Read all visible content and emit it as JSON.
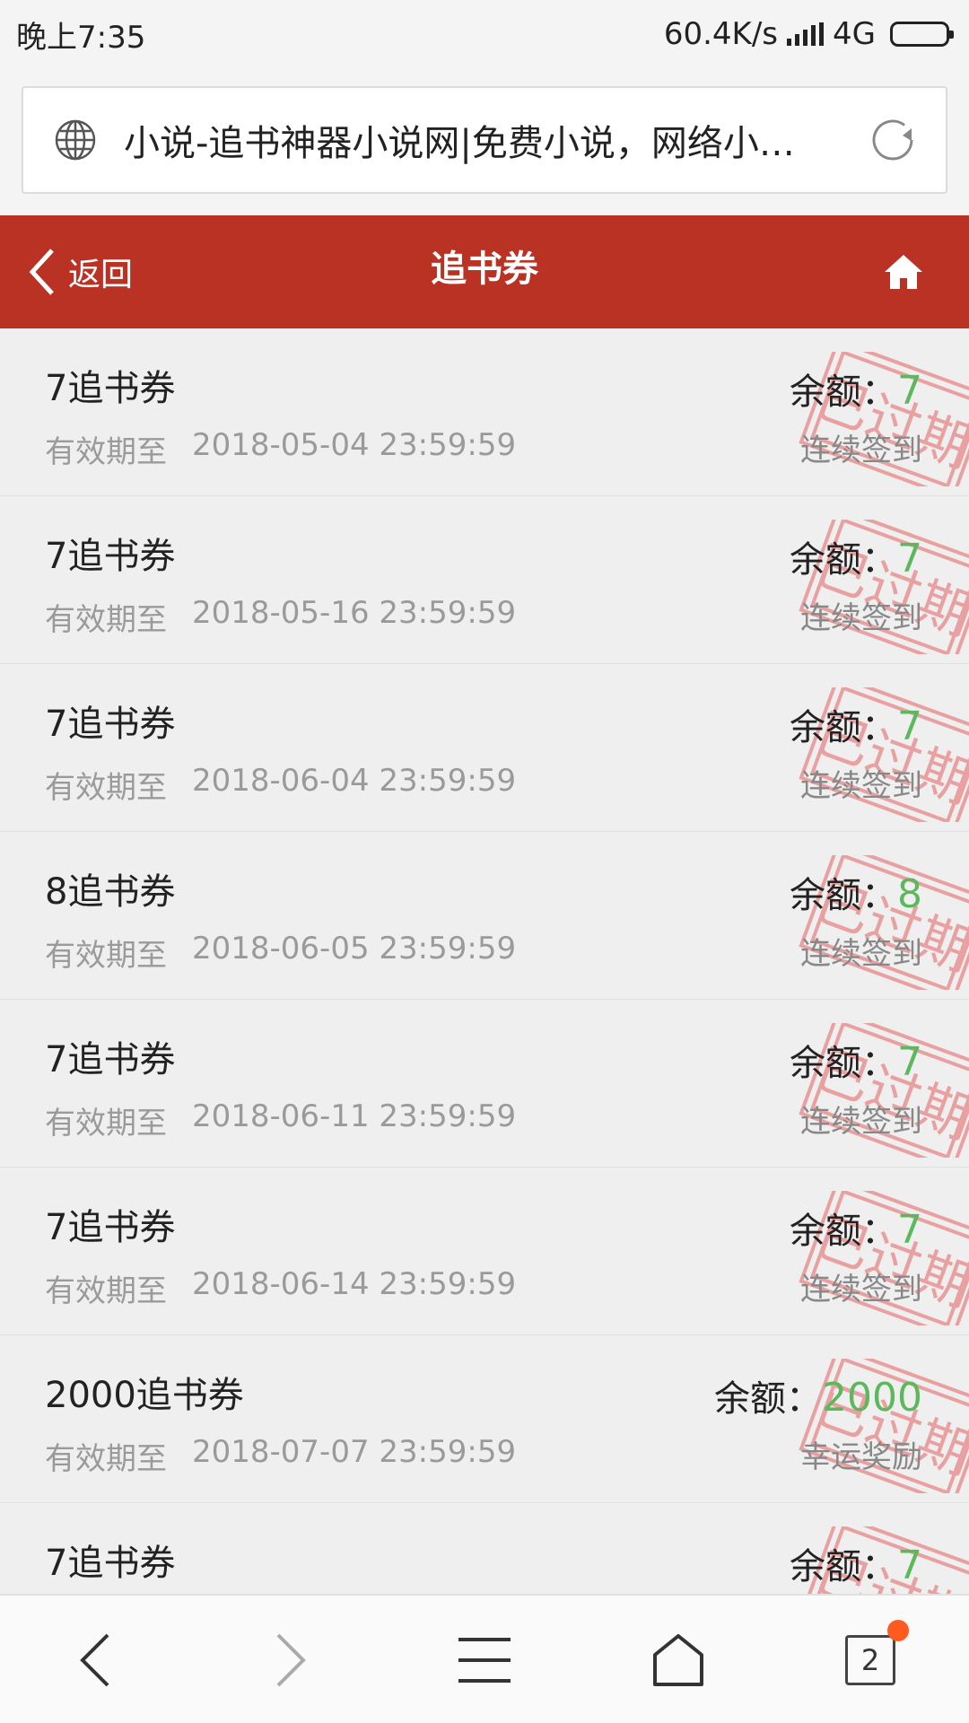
{
  "status_bar": {
    "time": "晚上7:35",
    "speed": "60.4K/s",
    "network": "4G"
  },
  "browser": {
    "page_title": "小说-追书神器小说网|免费小说，网络小…",
    "tabs_count": "2"
  },
  "header": {
    "back_label": "返回",
    "title": "追书券"
  },
  "labels": {
    "expiry_prefix": "有效期至",
    "balance_prefix": "余额："
  },
  "coupons": [
    {
      "title": "7追书券",
      "expiry": "2018-05-04 23:59:59",
      "balance": "7",
      "source": "连续签到"
    },
    {
      "title": "7追书券",
      "expiry": "2018-05-16 23:59:59",
      "balance": "7",
      "source": "连续签到"
    },
    {
      "title": "7追书券",
      "expiry": "2018-06-04 23:59:59",
      "balance": "7",
      "source": "连续签到"
    },
    {
      "title": "8追书券",
      "expiry": "2018-06-05 23:59:59",
      "balance": "8",
      "source": "连续签到"
    },
    {
      "title": "7追书券",
      "expiry": "2018-06-11 23:59:59",
      "balance": "7",
      "source": "连续签到"
    },
    {
      "title": "7追书券",
      "expiry": "2018-06-14 23:59:59",
      "balance": "7",
      "source": "连续签到"
    },
    {
      "title": "2000追书券",
      "expiry": "2018-07-07 23:59:59",
      "balance": "2000",
      "source": "幸运奖励"
    },
    {
      "title": "7追书券",
      "expiry": "",
      "balance": "7",
      "source": ""
    }
  ],
  "stamp_text": "已过期",
  "colors": {
    "header_bg": "#b93224",
    "balance_green": "#5cb85c",
    "stamp_red": "#e8a0a0",
    "badge_orange": "#ff5a1f"
  }
}
